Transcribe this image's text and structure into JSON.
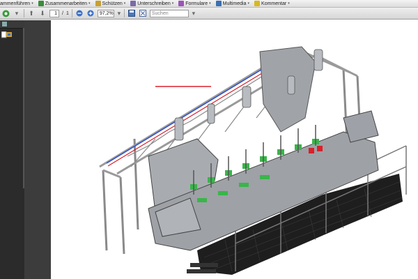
{
  "menu": [
    {
      "label": "ammenführen",
      "icon": "merge-icon",
      "color": "#4a78c2"
    },
    {
      "label": "Zusammenarbeiten",
      "icon": "collaborate-icon",
      "color": "#3b8c3b"
    },
    {
      "label": "Schützen",
      "icon": "lock-icon",
      "color": "#c8a030"
    },
    {
      "label": "Unterschreiben",
      "icon": "pen-icon",
      "color": "#7a6aa8"
    },
    {
      "label": "Formulare",
      "icon": "form-icon",
      "color": "#9a55b5"
    },
    {
      "label": "Multimedia",
      "icon": "film-icon",
      "color": "#3a6fb0"
    },
    {
      "label": "Kommentar",
      "icon": "comment-icon",
      "color": "#d8b820"
    }
  ],
  "toolbar": {
    "page_current": "1",
    "page_separator": "/",
    "page_total": "1",
    "zoom": "97,2%",
    "search_placeholder": "Suchen"
  },
  "colors": {
    "frame": "#8a8a8a",
    "frame_dark": "#4a4a4a",
    "machine_body": "#a6a9ad",
    "accent_green": "#39b54a",
    "accent_red": "#d8202a",
    "accent_blue": "#2a4fd0",
    "grating": "#222222"
  }
}
